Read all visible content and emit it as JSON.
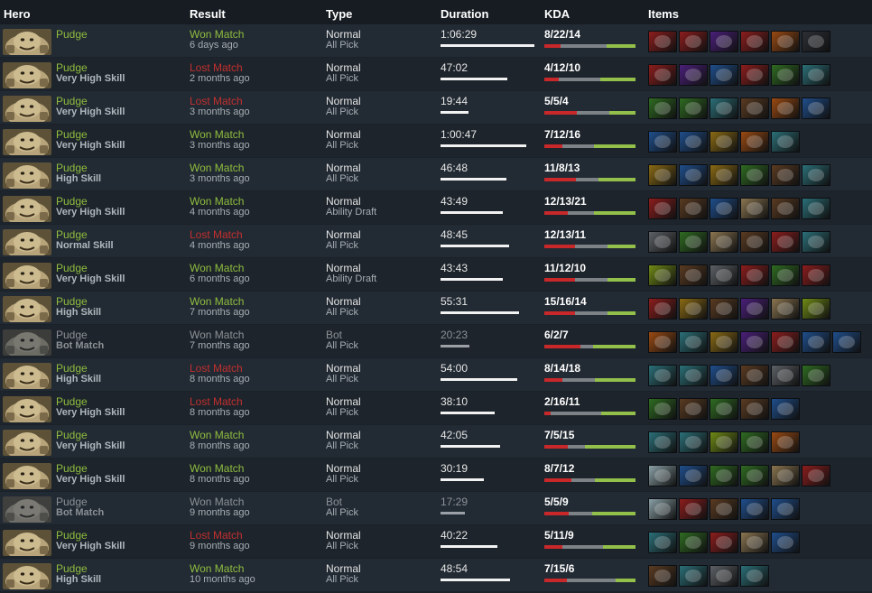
{
  "headers": {
    "hero": "Hero",
    "result": "Result",
    "type": "Type",
    "duration": "Duration",
    "kda": "KDA",
    "items": "Items"
  },
  "colors": {
    "won": "#8fbd3f",
    "lost": "#c2302f",
    "kills_bar": "#c8282a",
    "deaths_bar": "#7d8287",
    "assists_bar": "#93c04a"
  },
  "matches": [
    {
      "hero": "Pudge",
      "skill": "",
      "result": "Won Match",
      "outcome": "won",
      "time": "6 days ago",
      "type": "Normal",
      "mode": "All Pick",
      "duration": "1:06:29",
      "kda": "8/22/14",
      "k": 8,
      "d": 22,
      "a": 14,
      "bot": false,
      "items": [
        "fire-red",
        "mask-red",
        "portal-purple",
        "sword-red",
        "axe-orange",
        "dagger-dark"
      ]
    },
    {
      "hero": "Pudge",
      "skill": "Very High Skill",
      "result": "Lost Match",
      "outcome": "lost",
      "time": "2 months ago",
      "type": "Normal",
      "mode": "All Pick",
      "duration": "47:02",
      "kda": "4/12/10",
      "k": 4,
      "d": 12,
      "a": 10,
      "bot": false,
      "items": [
        "mask-red",
        "orb-purple",
        "gem-blue",
        "sword-red",
        "boot-green",
        "hook-teal"
      ]
    },
    {
      "hero": "Pudge",
      "skill": "Very High Skill",
      "result": "Lost Match",
      "outcome": "lost",
      "time": "3 months ago",
      "type": "Normal",
      "mode": "All Pick",
      "duration": "19:44",
      "kda": "5/5/4",
      "k": 5,
      "d": 5,
      "a": 4,
      "bot": false,
      "items": [
        "vial-green",
        "leaf-green",
        "hook-teal",
        "gauntlet-brown",
        "orb-orange",
        "gem-blue"
      ]
    },
    {
      "hero": "Pudge",
      "skill": "Very High Skill",
      "result": "Won Match",
      "outcome": "won",
      "time": "3 months ago",
      "type": "Normal",
      "mode": "All Pick",
      "duration": "1:00:47",
      "kda": "7/12/16",
      "k": 7,
      "d": 12,
      "a": 16,
      "bot": false,
      "items": [
        "helm-blue",
        "staff-blue",
        "fist-gold",
        "blade-orange",
        "hook-teal"
      ]
    },
    {
      "hero": "Pudge",
      "skill": "High Skill",
      "result": "Won Match",
      "outcome": "won",
      "time": "3 months ago",
      "type": "Normal",
      "mode": "All Pick",
      "duration": "46:48",
      "kda": "11/8/13",
      "k": 11,
      "d": 8,
      "a": 13,
      "bot": false,
      "items": [
        "fist-gold",
        "staff-blue",
        "orb-gold",
        "wand-green",
        "boot-brown",
        "hook-teal"
      ]
    },
    {
      "hero": "Pudge",
      "skill": "Very High Skill",
      "result": "Won Match",
      "outcome": "won",
      "time": "4 months ago",
      "type": "Normal",
      "mode": "Ability Draft",
      "duration": "43:49",
      "kda": "12/13/21",
      "k": 12,
      "d": 13,
      "a": 21,
      "bot": false,
      "items": [
        "gem-red",
        "boot-brown",
        "staff-blue",
        "scroll-tan",
        "box-brown",
        "armor-teal"
      ]
    },
    {
      "hero": "Pudge",
      "skill": "Normal Skill",
      "result": "Lost Match",
      "outcome": "lost",
      "time": "4 months ago",
      "type": "Normal",
      "mode": "All Pick",
      "duration": "48:45",
      "kda": "12/13/11",
      "k": 12,
      "d": 13,
      "a": 11,
      "bot": false,
      "items": [
        "gear-grey",
        "blade-green",
        "scroll-tan",
        "boot-brown",
        "axe-red",
        "hook-teal"
      ]
    },
    {
      "hero": "Pudge",
      "skill": "Very High Skill",
      "result": "Won Match",
      "outcome": "won",
      "time": "6 months ago",
      "type": "Normal",
      "mode": "Ability Draft",
      "duration": "43:43",
      "kda": "11/12/10",
      "k": 11,
      "d": 12,
      "a": 10,
      "bot": false,
      "items": [
        "claw-lime",
        "boot-brown",
        "mushroom-grey",
        "axe-red",
        "wand-green",
        "fire-red"
      ]
    },
    {
      "hero": "Pudge",
      "skill": "High Skill",
      "result": "Won Match",
      "outcome": "won",
      "time": "7 months ago",
      "type": "Normal",
      "mode": "All Pick",
      "duration": "55:31",
      "kda": "15/16/14",
      "k": 15,
      "d": 16,
      "a": 14,
      "bot": false,
      "items": [
        "star-red",
        "fist-gold",
        "boot-brown",
        "swords-purple",
        "scroll-tan",
        "claw-lime"
      ]
    },
    {
      "hero": "Pudge",
      "skill": "Bot Match",
      "result": "Won Match",
      "outcome": "won",
      "time": "7 months ago",
      "type": "Bot",
      "mode": "All Pick",
      "duration": "20:23",
      "kda": "6/2/7",
      "k": 6,
      "d": 2,
      "a": 7,
      "bot": true,
      "items": [
        "orb-orange",
        "hook-teal",
        "orb-gold",
        "orb-purple",
        "mask-red",
        "globe-blue",
        "gem-blue"
      ]
    },
    {
      "hero": "Pudge",
      "skill": "High Skill",
      "result": "Lost Match",
      "outcome": "lost",
      "time": "8 months ago",
      "type": "Normal",
      "mode": "All Pick",
      "duration": "54:00",
      "kda": "8/14/18",
      "k": 8,
      "d": 14,
      "a": 18,
      "bot": false,
      "items": [
        "hook-teal",
        "scythe-teal",
        "gem-blue",
        "boot-brown",
        "armor-grey",
        "staff-green"
      ]
    },
    {
      "hero": "Pudge",
      "skill": "Very High Skill",
      "result": "Lost Match",
      "outcome": "lost",
      "time": "8 months ago",
      "type": "Normal",
      "mode": "All Pick",
      "duration": "38:10",
      "kda": "2/16/11",
      "k": 2,
      "d": 16,
      "a": 11,
      "bot": false,
      "items": [
        "shield-green",
        "boot-brown",
        "wand-green",
        "claw-brown",
        "gem-blue"
      ]
    },
    {
      "hero": "Pudge",
      "skill": "Very High Skill",
      "result": "Won Match",
      "outcome": "won",
      "time": "8 months ago",
      "type": "Normal",
      "mode": "All Pick",
      "duration": "42:05",
      "kda": "7/5/15",
      "k": 7,
      "d": 5,
      "a": 15,
      "bot": false,
      "items": [
        "hook-teal",
        "scythe-teal",
        "claw-lime",
        "vial-green",
        "blade-orange"
      ]
    },
    {
      "hero": "Pudge",
      "skill": "Very High Skill",
      "result": "Won Match",
      "outcome": "won",
      "time": "8 months ago",
      "type": "Normal",
      "mode": "All Pick",
      "duration": "30:19",
      "kda": "8/7/12",
      "k": 8,
      "d": 7,
      "a": 12,
      "bot": false,
      "items": [
        "swirl-white",
        "globe-blue",
        "shield-green",
        "wand-green",
        "scroll-tan",
        "gem-red"
      ]
    },
    {
      "hero": "Pudge",
      "skill": "Bot Match",
      "result": "Won Match",
      "outcome": "won",
      "time": "9 months ago",
      "type": "Bot",
      "mode": "All Pick",
      "duration": "17:29",
      "kda": "5/5/9",
      "k": 5,
      "d": 5,
      "a": 9,
      "bot": true,
      "items": [
        "swirl-white",
        "mask-red",
        "ball-brown",
        "gem-blue",
        "globe-blue"
      ]
    },
    {
      "hero": "Pudge",
      "skill": "Very High Skill",
      "result": "Lost Match",
      "outcome": "lost",
      "time": "9 months ago",
      "type": "Normal",
      "mode": "All Pick",
      "duration": "40:22",
      "kda": "5/11/9",
      "k": 5,
      "d": 11,
      "a": 9,
      "bot": false,
      "items": [
        "hook-teal",
        "vial-green",
        "axe-red",
        "scroll-tan",
        "globe-blue"
      ]
    },
    {
      "hero": "Pudge",
      "skill": "High Skill",
      "result": "Won Match",
      "outcome": "won",
      "time": "10 months ago",
      "type": "Normal",
      "mode": "All Pick",
      "duration": "48:54",
      "kda": "7/15/6",
      "k": 7,
      "d": 15,
      "a": 6,
      "bot": false,
      "items": [
        "boot-brown",
        "mask-teal",
        "armor-grey",
        "hook-teal"
      ]
    }
  ]
}
